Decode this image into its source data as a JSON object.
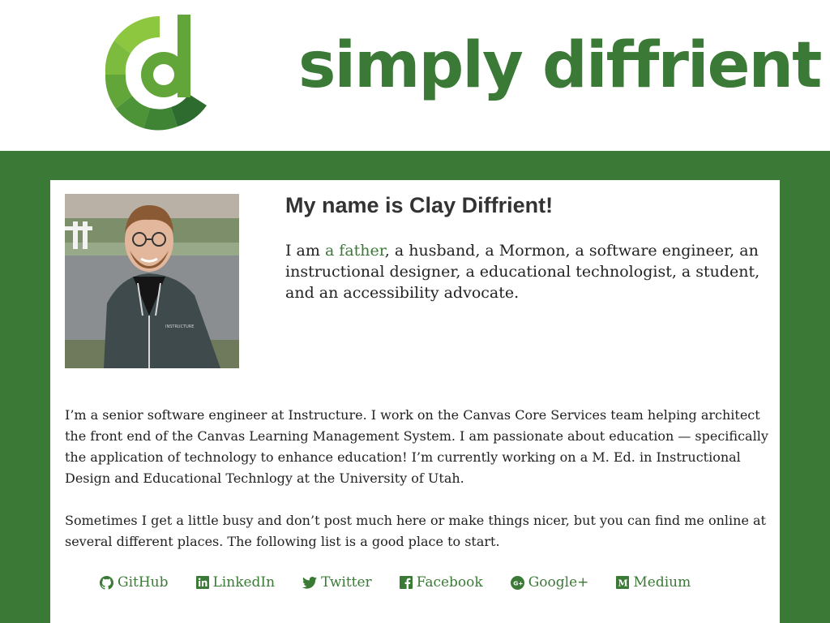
{
  "header": {
    "logo_alt": "cd",
    "title": "simply diffrient"
  },
  "intro": {
    "heading": "My name is Clay Diffrient!",
    "text_before": "I am ",
    "father_link": "a father",
    "text_after": ", a husband, a Mormon, a software engineer, an instructional designer, a educational technologist, a student, and an accessibility advocate."
  },
  "photo": {
    "shirt_text": "INSTRUCTURE"
  },
  "paragraphs": [
    "I’m a senior software engineer at Instructure. I work on the Canvas Core Services team helping architect the front end of the Canvas Learning Management System. I am passionate about education — specifically the application of technology to enhance education! I’m currently working on a M. Ed. in Instructional Design and Educational Technlogy at the University of Utah.",
    "Sometimes I get a little busy and don’t post much here or make things nicer, but you can find me online at several different places. The following list is a good place to start."
  ],
  "social_links": [
    {
      "label": "GitHub",
      "icon": "github-icon"
    },
    {
      "label": "LinkedIn",
      "icon": "linkedin-icon"
    },
    {
      "label": "Twitter",
      "icon": "twitter-icon"
    },
    {
      "label": "Facebook",
      "icon": "facebook-icon"
    },
    {
      "label": "Google+",
      "icon": "google-plus-icon"
    },
    {
      "label": "Medium",
      "icon": "medium-icon"
    }
  ],
  "colors": {
    "brand_green": "#3a7a36",
    "logo_light": "#8dc63f",
    "logo_dark": "#2e6b2f"
  }
}
